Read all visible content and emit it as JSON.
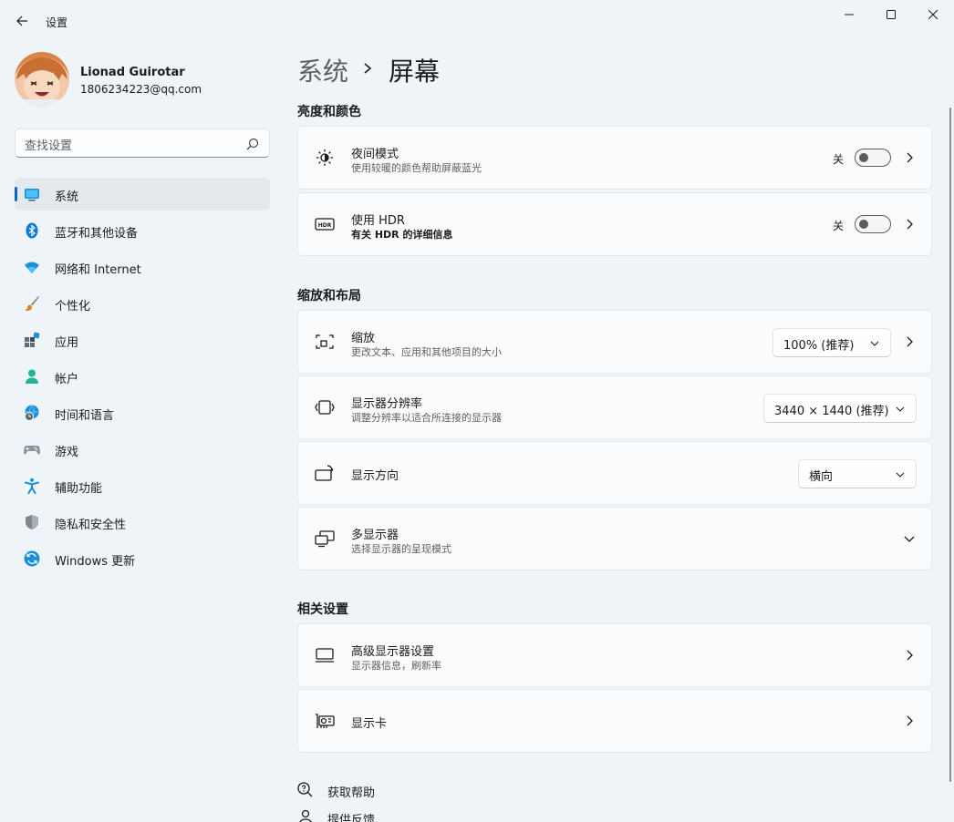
{
  "app": {
    "title": "设置"
  },
  "profile": {
    "name": "Lionad Guirotar",
    "email": "1806234223@qq.com"
  },
  "search": {
    "placeholder": "查找设置"
  },
  "sidebar": {
    "items": [
      {
        "label": "系统",
        "icon": "system-icon",
        "active": true
      },
      {
        "label": "蓝牙和其他设备",
        "icon": "bluetooth-icon"
      },
      {
        "label": "网络和 Internet",
        "icon": "wifi-icon"
      },
      {
        "label": "个性化",
        "icon": "brush-icon"
      },
      {
        "label": "应用",
        "icon": "apps-icon"
      },
      {
        "label": "帐户",
        "icon": "account-icon"
      },
      {
        "label": "时间和语言",
        "icon": "globe-clock-icon"
      },
      {
        "label": "游戏",
        "icon": "gamepad-icon"
      },
      {
        "label": "辅助功能",
        "icon": "accessibility-icon"
      },
      {
        "label": "隐私和安全性",
        "icon": "shield-icon"
      },
      {
        "label": "Windows 更新",
        "icon": "update-icon"
      }
    ]
  },
  "breadcrumb": {
    "parent": "系统",
    "current": "屏幕"
  },
  "sections": {
    "brightness": "亮度和颜色",
    "scale_layout": "缩放和布局",
    "related": "相关设置"
  },
  "cards": {
    "night_light": {
      "title": "夜间模式",
      "subtitle": "使用较暖的颜色帮助屏蔽蓝光",
      "state": "关"
    },
    "hdr": {
      "title": "使用 HDR",
      "subtitle": "有关 HDR 的详细信息",
      "state": "关"
    },
    "scale": {
      "title": "缩放",
      "subtitle": "更改文本、应用和其他项目的大小",
      "value": "100% (推荐)"
    },
    "resolution": {
      "title": "显示器分辨率",
      "subtitle": "调整分辨率以适合所连接的显示器",
      "value": "3440 × 1440 (推荐)"
    },
    "orientation": {
      "title": "显示方向",
      "value": "横向"
    },
    "multi_display": {
      "title": "多显示器",
      "subtitle": "选择显示器的呈现模式"
    },
    "advanced": {
      "title": "高级显示器设置",
      "subtitle": "显示器信息，刷新率"
    },
    "graphics": {
      "title": "显示卡"
    }
  },
  "footer": {
    "help": "获取帮助",
    "feedback": "提供反馈"
  },
  "colors": {
    "accent": "#0067c0",
    "background": "#eef4f7",
    "card": "#f9fbfc"
  }
}
